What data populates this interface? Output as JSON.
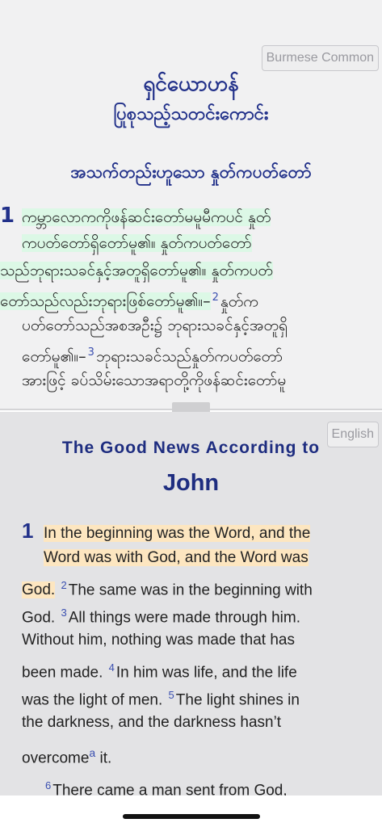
{
  "top_pane": {
    "language_button": "Burmese Common",
    "title_line1": "ရှင်ယောဟန်",
    "title_line2": "ပြုစုသည့်သတင်းကောင်း",
    "section_heading": "အသက်တည်းဟူသော နှုတ်ကပတ်တော်",
    "chapter": "1",
    "lines": [
      "ကမ္ဘာလောကကိုဖန်ဆင်းတော်မမူမီကပင် နှုတ်",
      "ကပတ်တော်ရှိတော်မူ၏။ နှုတ်ကပတ်တော်",
      "သည်ဘုရားသခင်နှင့်အတူရှိတော်မူ၏။ နှုတ်ကပတ်",
      "တော်သည်လည်းဘုရားဖြစ်တော်မူ၏။–",
      "2",
      "နှုတ်က",
      "ပတ်တော်သည်အစအဦး၌ ဘုရားသခင်နှင့်အတူရှိ",
      "တော်မူ၏။–",
      "3",
      "ဘုရားသခင်သည်နှုတ်ကပတ်တော်",
      "အားဖြင့် ခပ်သိမ်းသောအရာတို့ကိုဖန်ဆင်းတော်မူ"
    ]
  },
  "bottom_pane": {
    "language_button": "English",
    "title_line1": "The Good News According to",
    "title_line2": "John",
    "chapter": "1",
    "verse_numbers": [
      "2",
      "3",
      "4",
      "5",
      "6"
    ],
    "footnote_mark": "a",
    "text": {
      "l1": "In the beginning was the Word, and the",
      "l2": "Word was with God, and the Word was",
      "l3a": "God.",
      "l3b": "The same was in the beginning with",
      "l4a": "God.",
      "l4b": "All things were made through him.",
      "l5": "Without him, nothing was made that has",
      "l6a": "been made.",
      "l6b": "In him was life, and the life",
      "l7a": "was the light of men.",
      "l7b": "The light shines in",
      "l8": "the darkness, and the darkness hasn’t",
      "l9a": "overcome",
      "l9b": " it.",
      "l10": "There came a man sent from God,"
    }
  },
  "colors": {
    "title_blue": "#22318a",
    "verse_highlight_burmese": "#dcf8e6",
    "verse_highlight_english": "#fde6c0"
  }
}
